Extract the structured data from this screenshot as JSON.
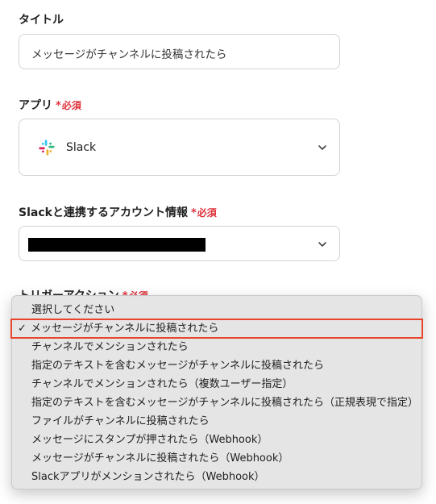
{
  "title_field": {
    "label": "タイトル",
    "value": "メッセージがチャンネルに投稿されたら"
  },
  "app_field": {
    "label": "アプリ",
    "required_label": "必須",
    "required_mark": "*",
    "value": "Slack",
    "icon": "slack-logo-icon"
  },
  "account_field": {
    "label": "Slackと連携するアカウント情報",
    "required_label": "必須",
    "required_mark": "*",
    "value_redacted": true
  },
  "trigger_field": {
    "label": "トリガーアクション",
    "required_label": "必須",
    "required_mark": "*"
  },
  "dropdown": {
    "selected_index": 1,
    "check_mark": "✓",
    "options": [
      "選択してください",
      "メッセージがチャンネルに投稿されたら",
      "チャンネルでメンションされたら",
      "指定のテキストを含むメッセージがチャンネルに投稿されたら",
      "チャンネルでメンションされたら（複数ユーザー指定）",
      "指定のテキストを含むメッセージがチャンネルに投稿されたら（正規表現で指定）",
      "ファイルがチャンネルに投稿されたら",
      "メッセージにスタンプが押されたら（Webhook）",
      "メッセージがチャンネルに投稿されたら（Webhook）",
      "Slackアプリがメンションされたら（Webhook）"
    ]
  },
  "colors": {
    "required": "#e0323c",
    "highlight_border": "#e8452c",
    "field_border": "#cfd3d8"
  }
}
